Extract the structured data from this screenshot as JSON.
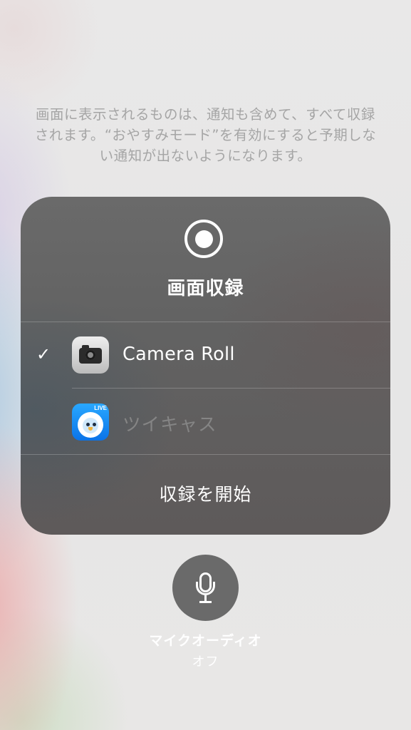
{
  "notice": {
    "line1": "画面に表示されるものは、通知も含めて、すべて収録",
    "line2": "されます。“おやすみモード”を有効にすると予期しな",
    "line3": "い通知が出ないようになります。"
  },
  "panel": {
    "title": "画面収録",
    "destinations": [
      {
        "label": "Camera Roll",
        "icon": "camera-app-icon",
        "selected": true
      },
      {
        "label": "ツイキャス",
        "icon": "twitcasting-app-icon",
        "selected": false
      }
    ],
    "check_glyph": "✓",
    "start_label": "収録を開始"
  },
  "twicas_icon": {
    "badge": "LIVE"
  },
  "mic": {
    "label": "マイクオーディオ",
    "status": "オフ"
  },
  "colors": {
    "panel": "#646464",
    "text_primary": "#ffffff",
    "text_disabled": "#858585",
    "notice_text": "#a5a5a5"
  }
}
